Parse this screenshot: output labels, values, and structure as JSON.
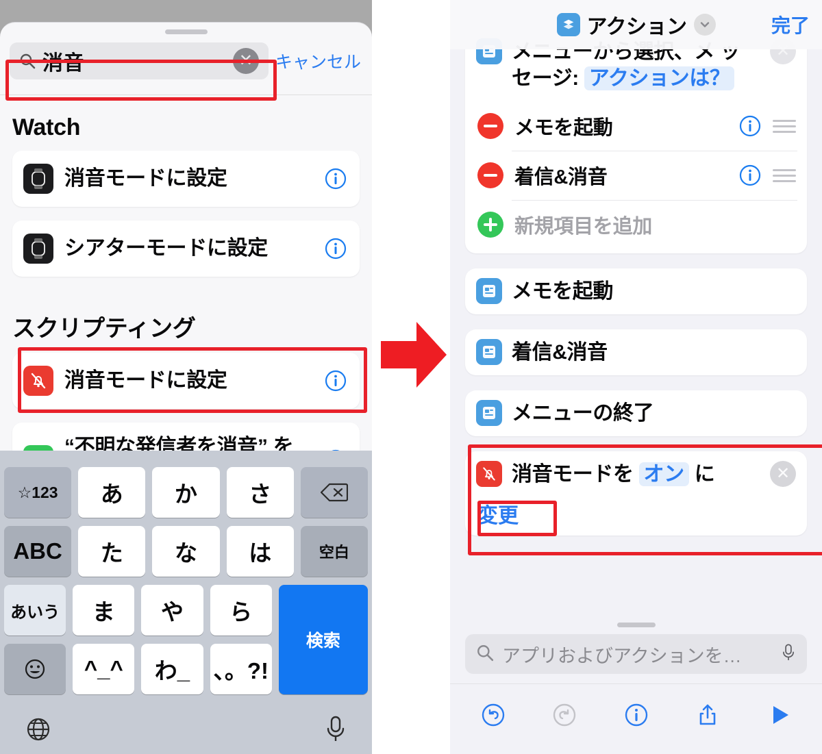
{
  "left": {
    "search": {
      "value": "消音",
      "icon": "search-icon",
      "clear_icon": "clear-icon",
      "cancel_label": "キャンセル"
    },
    "sections": [
      {
        "title": "Watch",
        "items": [
          {
            "label": "消音モードに設定",
            "icon": "apple-watch-icon",
            "info": "info-icon"
          },
          {
            "label": "シアターモードに設定",
            "icon": "apple-watch-icon",
            "info": "info-icon"
          }
        ]
      },
      {
        "title": "スクリプティング",
        "items": [
          {
            "label": "消音モードに設定",
            "icon": "mute-bell-icon",
            "info": "info-icon",
            "highlighted": true
          },
          {
            "label": "“不明な発信者を消音” を設定",
            "icon": "phone-arrow-icon",
            "info": "info-icon"
          }
        ]
      }
    ],
    "keyboard": {
      "row1": [
        "☆123",
        "あ",
        "か",
        "さ",
        "delete-icon"
      ],
      "row2": [
        "ABC",
        "た",
        "な",
        "は",
        "空白"
      ],
      "row3": [
        "あいう",
        "ま",
        "や",
        "ら"
      ],
      "row4": [
        "emoji-icon",
        "^_^",
        "わ_",
        "、。?!"
      ],
      "search_key": "検索",
      "globe": "globe-icon",
      "mic": "microphone-icon"
    }
  },
  "arrow": {
    "name": "red-right-arrow",
    "color": "#ee1d23"
  },
  "right": {
    "header": {
      "title": "アクション",
      "app_icon": "shortcuts-layers-icon",
      "chevron": "chevron-down-icon",
      "done_label": "完了"
    },
    "clipped_card": {
      "icon": "scripting-icon",
      "text_part1": "メニューから選択、メ",
      "text_part2": "ッセージ:",
      "token": "アクションは？",
      "close_icon": "close-icon"
    },
    "menu_items": [
      {
        "label": "メモを起動",
        "control": "remove-icon",
        "info": "info-icon",
        "handle": "drag-handle-icon"
      },
      {
        "label": "着信&消音",
        "control": "remove-icon",
        "info": "info-icon",
        "handle": "drag-handle-icon"
      }
    ],
    "add_item": {
      "label": "新規項目を追加",
      "control": "add-icon"
    },
    "action_cards": [
      {
        "label": "メモを起動",
        "icon": "scripting-icon"
      },
      {
        "label": "着信&消音",
        "icon": "scripting-icon"
      },
      {
        "label": "メニューの終了",
        "icon": "scripting-icon"
      }
    ],
    "mute_card": {
      "icon": "mute-bell-icon",
      "text_before": "消音モードを",
      "token": "オン",
      "text_after": "に",
      "change_label": "変更",
      "close_icon": "close-icon",
      "highlighted": true
    },
    "bottom_search": {
      "placeholder": "アプリおよびアクションを…",
      "search_icon": "search-icon",
      "mic_icon": "microphone-icon"
    },
    "toolbar": [
      {
        "name": "undo-icon",
        "state": "enabled"
      },
      {
        "name": "redo-icon",
        "state": "disabled"
      },
      {
        "name": "info-icon",
        "state": "enabled"
      },
      {
        "name": "share-icon",
        "state": "enabled"
      },
      {
        "name": "play-icon",
        "state": "enabled"
      }
    ]
  },
  "colors": {
    "accent": "#2b7cf0",
    "highlight": "#e8212a",
    "red": "#f0352b",
    "green": "#34c759"
  }
}
